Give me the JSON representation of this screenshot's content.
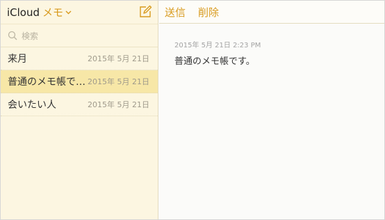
{
  "sidebar": {
    "title": "iCloud",
    "title_accent": "メモ",
    "search_placeholder": "検索",
    "notes": [
      {
        "title": "来月",
        "date": "2015年 5月 21日"
      },
      {
        "title": "普通のメモ帳です。",
        "date": "2015年 5月 21日"
      },
      {
        "title": "会いたい人",
        "date": "2015年 5月 21日"
      }
    ]
  },
  "toolbar": {
    "send_label": "送信",
    "delete_label": "削除"
  },
  "note": {
    "date": "2015年 5月 21日 2:23 PM",
    "body": "普通のメモ帳です。"
  },
  "colors": {
    "accent": "#d89a1d",
    "sidebar_bg": "#fcf6e1",
    "selected_bg": "#f7e7a7"
  },
  "icons": [
    "chevron-down-icon",
    "compose-icon",
    "search-icon"
  ]
}
